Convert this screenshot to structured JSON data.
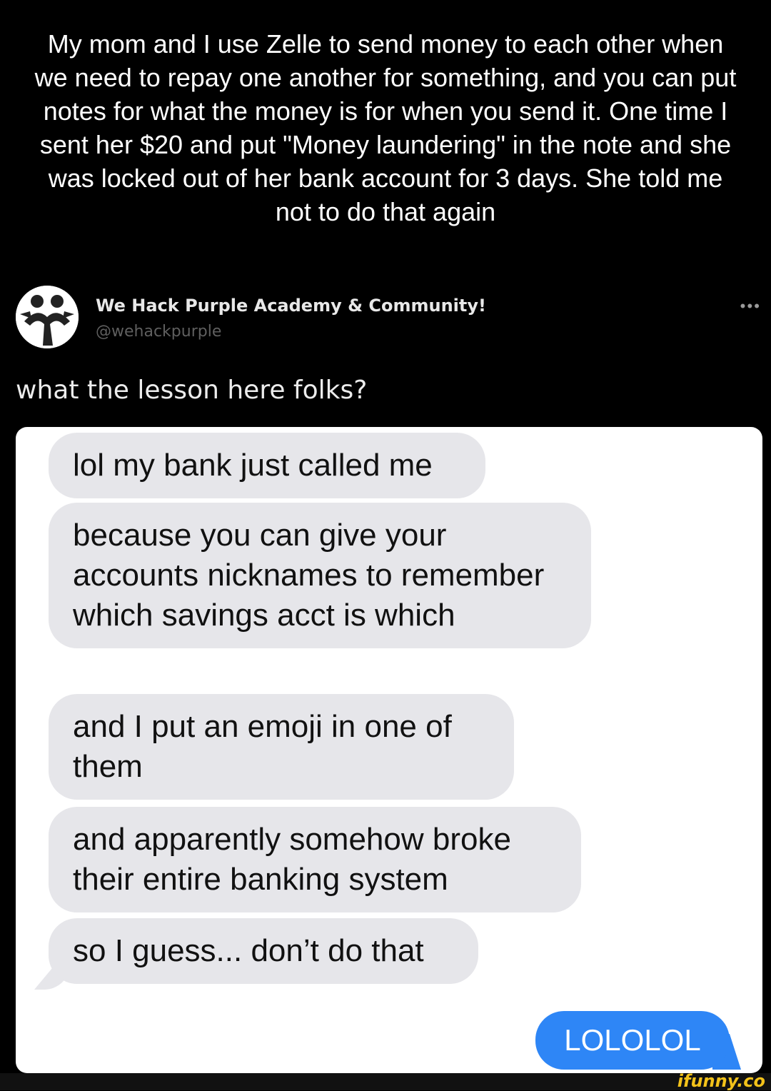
{
  "caption": "My mom and I use Zelle to send money to each other when we need to repay one another for something, and you can put notes for what the money is for when you send it. One time I sent her $20 and put \"Money laundering\" in the note and she was locked out of her bank account for 3 days. She told me not to do that again",
  "post": {
    "author_name": "We Hack Purple Academy & Community!",
    "author_handle": "@wehackpurple",
    "text": "what the lesson here folks?",
    "more_icon": "more-options-icon"
  },
  "messages": {
    "incoming": [
      "lol my bank just called me",
      "because you can give your accounts nicknames to remember which savings acct is which",
      "and I put an emoji in one of them",
      "and apparently somehow broke their entire banking system",
      "so I guess... don’t do that"
    ],
    "outgoing": "LOLOLOL"
  },
  "watermark": "ifunny.co",
  "colors": {
    "background": "#000000",
    "incoming_bubble": "#e6e6ea",
    "outgoing_bubble": "#2e86f6",
    "watermark": "#f3c21a"
  }
}
